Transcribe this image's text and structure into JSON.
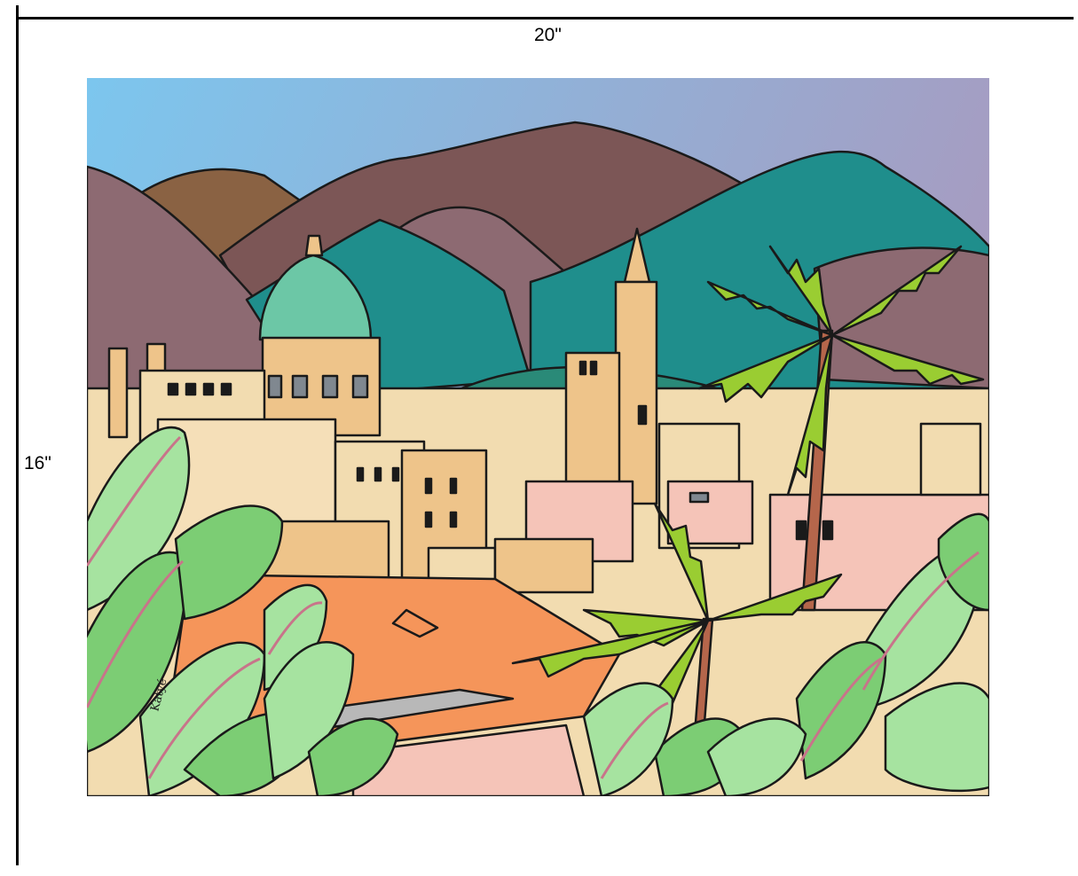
{
  "dimensions": {
    "width_label": "20\"",
    "height_label": "16\""
  },
  "painting": {
    "signature": "Katyé",
    "colors": {
      "sky_top": "#7cc6ee",
      "sky_bottom": "#a79bc0",
      "mountain_brown": "#8a6243",
      "mountain_mauve": "#8d6a72",
      "mountain_teal": "#1f8e8c",
      "dome": "#6cc7a6",
      "building_cream": "#f2dcb0",
      "building_tan": "#eec48a",
      "building_pink": "#f5c4b8",
      "roof_orange": "#f5955a",
      "window_grey": "#808890",
      "palm_green": "#9acd32",
      "palm_trunk": "#b5664b",
      "leaf_light": "#a6e3a0",
      "leaf_mid": "#7ccd74",
      "leaf_vein": "#c8748a"
    }
  }
}
